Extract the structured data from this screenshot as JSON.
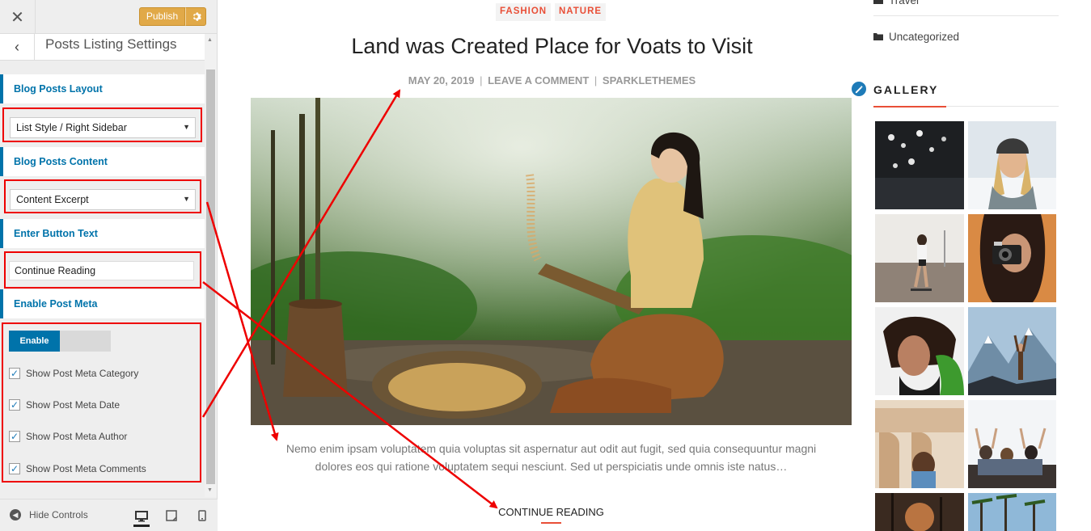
{
  "customizer": {
    "publish_label": "Publish",
    "section_title": "Posts Listing Settings",
    "controls": {
      "layout_label": "Blog Posts Layout",
      "layout_value": "List Style / Right Sidebar",
      "content_label": "Blog Posts Content",
      "content_value": "Content Excerpt",
      "button_text_label": "Enter Button Text",
      "button_text_value": "Continue Reading",
      "post_meta_label": "Enable Post Meta",
      "toggle_label": "Enable",
      "checkboxes": [
        {
          "label": "Show Post Meta Category",
          "checked": true
        },
        {
          "label": "Show Post Meta Date",
          "checked": true
        },
        {
          "label": "Show Post Meta Author",
          "checked": true
        },
        {
          "label": "Show Post Meta Comments",
          "checked": true
        }
      ]
    },
    "footer": {
      "hide_controls_label": "Hide Controls",
      "devices": [
        "desktop-icon",
        "tablet-icon",
        "mobile-icon"
      ]
    }
  },
  "post": {
    "categories": [
      "FASHION",
      "NATURE"
    ],
    "title": "Land was Created Place for Voats to Visit",
    "meta": {
      "date": "MAY 20, 2019",
      "comments": "LEAVE A COMMENT",
      "author": "SPARKLETHEMES",
      "separator": "|"
    },
    "excerpt_line1": "Nemo enim ipsam voluptatem quia voluptas sit aspernatur aut odit aut fugit, sed quia consequuntur magni",
    "excerpt_line2": "dolores eos qui ratione voluptatem sequi nesciunt. Sed ut perspiciatis unde omnis iste natus…",
    "continue_label": "CONTINUE READING"
  },
  "sidebar": {
    "categories": [
      "Travel",
      "Uncategorized"
    ],
    "gallery_title": "GALLERY"
  },
  "colors": {
    "accent": "#e94f37",
    "customizer_blue": "#0073aa",
    "publish": "#e1a948",
    "annotation": "#ee0000"
  }
}
